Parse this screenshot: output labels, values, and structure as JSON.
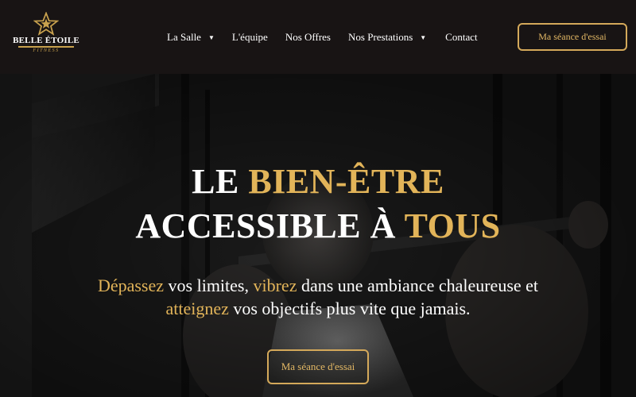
{
  "brand": {
    "name": "BELLE ÉTOILE",
    "tagline": "FITNESS",
    "accent_color": "#e2b459",
    "logo_icon": "star-icon"
  },
  "nav": {
    "items": [
      {
        "label": "La Salle",
        "has_dropdown": true
      },
      {
        "label": "L'équipe",
        "has_dropdown": false
      },
      {
        "label": "Nos Offres",
        "has_dropdown": false
      },
      {
        "label": "Nos Prestations",
        "has_dropdown": true
      },
      {
        "label": "Contact",
        "has_dropdown": false
      }
    ],
    "dropdown_icon": "caret-down-icon",
    "cta_label": "Ma séance d'essai"
  },
  "hero": {
    "title_line1_white": "LE ",
    "title_line1_gold": "BIEN-ÊTRE",
    "title_line2_white": "ACCESSIBLE À ",
    "title_line2_gold": "TOUS",
    "subtitle": {
      "w1": "Dépassez",
      "t1": " vos limites, ",
      "w2": "vibrez",
      "t2": " dans une ambiance chaleureuse et",
      "w3": "atteignez",
      "t3": " vos objectifs plus vite que jamais."
    },
    "cta_label": "Ma séance d'essai"
  }
}
